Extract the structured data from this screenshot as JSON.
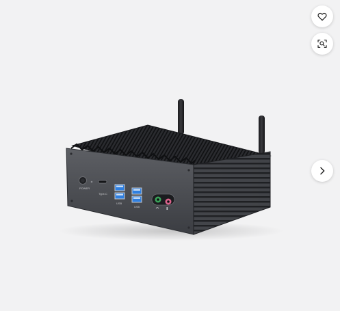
{
  "product_image": {
    "device_labels": {
      "power": "POWER",
      "typec": "Type-C",
      "usb_left": "USB",
      "usb_right": "USB"
    }
  },
  "controls": {
    "favorite": {
      "icon": "heart-icon"
    },
    "visual_search": {
      "icon": "scan-search-icon"
    },
    "next": {
      "icon": "chevron-right-icon"
    }
  },
  "colors": {
    "background": "#f2f2f3",
    "button_bg": "#ffffff",
    "icon": "#222222",
    "usb_blue": "#2f7fe0",
    "audio_green": "#3aa35a",
    "audio_pink": "#d8638b"
  }
}
